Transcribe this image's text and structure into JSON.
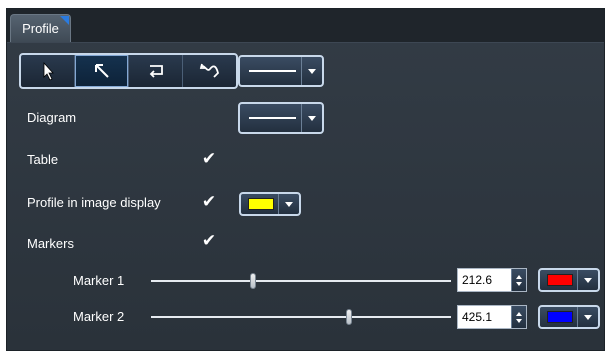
{
  "tab": {
    "label": "Profile"
  },
  "tools": [
    {
      "name": "pointer",
      "active": false
    },
    {
      "name": "line-arrow",
      "active": true
    },
    {
      "name": "rectangle-loop",
      "active": false
    },
    {
      "name": "freehand",
      "active": false
    }
  ],
  "rows": {
    "diagram": {
      "label": "Diagram"
    },
    "table": {
      "label": "Table",
      "checked": true
    },
    "profile_display": {
      "label": "Profile in image display",
      "checked": true,
      "color": "#ffff00"
    },
    "markers": {
      "label": "Markers",
      "checked": true
    }
  },
  "marker1": {
    "label": "Marker 1",
    "value": "212.6",
    "color": "#ff0000",
    "position_fraction": 0.34
  },
  "marker2": {
    "label": "Marker 2",
    "value": "425.1",
    "color": "#0000ff",
    "position_fraction": 0.66
  },
  "check_glyph": "✔"
}
